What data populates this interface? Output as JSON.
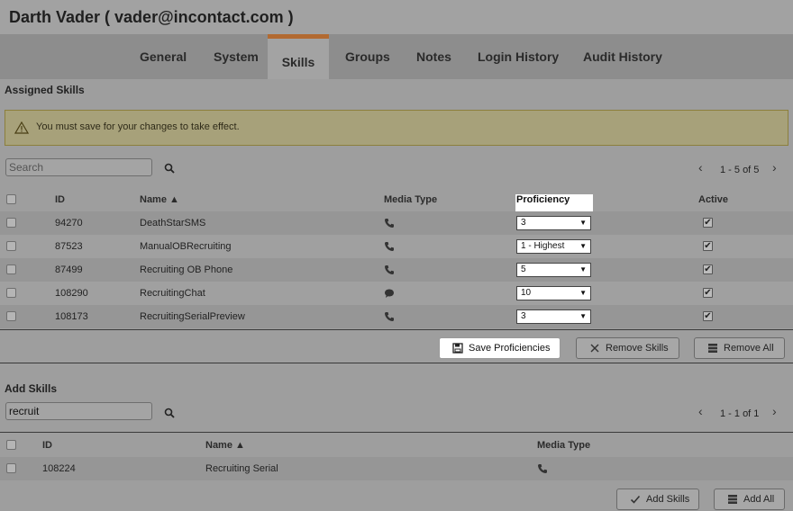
{
  "header": {
    "title": "Darth Vader ( vader@incontact.com )"
  },
  "tabs": [
    {
      "label": "General"
    },
    {
      "label": "System"
    },
    {
      "label": "Skills"
    },
    {
      "label": "Groups"
    },
    {
      "label": "Notes"
    },
    {
      "label": "Login History"
    },
    {
      "label": "Audit History"
    }
  ],
  "active_tab": "Skills",
  "assigned": {
    "section_label": "Assigned Skills",
    "warning": "You must save for your changes to take effect.",
    "search": {
      "placeholder": "Search",
      "value": ""
    },
    "pager": {
      "text": "1 - 5 of 5",
      "prev": "‹",
      "next": "›"
    },
    "columns": {
      "id": "ID",
      "name": "Name ▲",
      "media": "Media Type",
      "proficiency": "Proficiency",
      "active": "Active"
    },
    "rows": [
      {
        "id": "94270",
        "name": "DeathStarSMS",
        "media": "phone-icon",
        "proficiency": "3",
        "active": true
      },
      {
        "id": "87523",
        "name": "ManualOBRecruiting",
        "media": "phone-icon",
        "proficiency": "1 - Highest",
        "active": true
      },
      {
        "id": "87499",
        "name": "Recruiting OB Phone",
        "media": "phone-icon",
        "proficiency": "5",
        "active": true
      },
      {
        "id": "108290",
        "name": "RecruitingChat",
        "media": "chat-icon",
        "proficiency": "10",
        "active": true
      },
      {
        "id": "108173",
        "name": "RecruitingSerialPreview",
        "media": "phone-icon",
        "proficiency": "3",
        "active": true
      }
    ],
    "buttons": {
      "save": "Save Proficiencies",
      "remove": "Remove Skills",
      "remove_all": "Remove All"
    }
  },
  "add": {
    "section_label": "Add Skills",
    "search": {
      "placeholder": "",
      "value": "recruit"
    },
    "pager": {
      "text": "1 - 1 of 1",
      "prev": "‹",
      "next": "›"
    },
    "columns": {
      "id": "ID",
      "name": "Name ▲",
      "media": "Media Type"
    },
    "rows": [
      {
        "id": "108224",
        "name": "Recruiting Serial",
        "media": "phone-icon"
      }
    ],
    "buttons": {
      "add": "Add Skills",
      "add_all": "Add All"
    }
  },
  "colors": {
    "accent": "#b26a31",
    "overlay": "#9e9e9e"
  }
}
